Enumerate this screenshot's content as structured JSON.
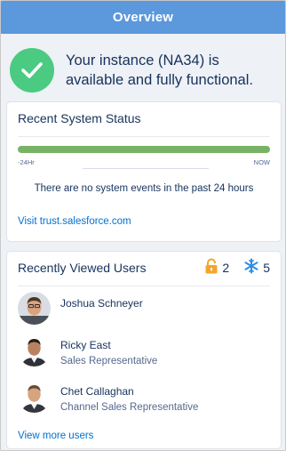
{
  "header": {
    "title": "Overview"
  },
  "banner": {
    "icon": "checkmark-icon",
    "color": "#4bca81",
    "text_line1": "Your instance (NA34) is",
    "text_line2": "available and fully functional."
  },
  "system_status": {
    "title": "Recent System Status",
    "bar_color": "#79b265",
    "start_label": "-24Hr",
    "end_label": "NOW",
    "message": "There are no system events in the past 24 hours",
    "link": "Visit trust.salesforce.com"
  },
  "recent_users": {
    "title": "Recently Viewed Users",
    "locked_count": "2",
    "frozen_count": "5",
    "users": [
      {
        "name": "Joshua Schneyer",
        "role": ""
      },
      {
        "name": "Ricky East",
        "role": "Sales Representative"
      },
      {
        "name": "Chet Callaghan",
        "role": "Channel Sales Representative"
      }
    ],
    "more_link": "View more users"
  },
  "colors": {
    "header_bg": "#5b98dc",
    "link": "#0070d2",
    "lock_icon": "#f4a52f",
    "freeze_icon": "#2a8ee8"
  }
}
